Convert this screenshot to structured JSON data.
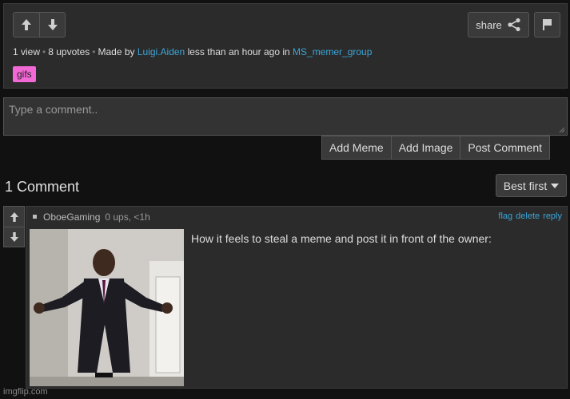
{
  "post": {
    "views": "1 view",
    "upvotes": "8 upvotes",
    "made_by_prefix": "Made by",
    "author": "Luigi.Aiden",
    "time_text": "less than an hour ago in",
    "group": "MS_memer_group",
    "share_label": "share",
    "tag": "gifs"
  },
  "comment_form": {
    "placeholder": "Type a comment..",
    "add_meme": "Add Meme",
    "add_image": "Add Image",
    "post_comment": "Post Comment"
  },
  "comments_header": {
    "count": "1 Comment",
    "sort_label": "Best first"
  },
  "comment": {
    "user": "OboeGaming",
    "stats": "0 ups, <1h",
    "actions": [
      "flag",
      "delete",
      "reply"
    ],
    "text": "How it feels to steal a meme and post it in front of the owner:"
  },
  "watermark": "imgflip.com",
  "colors": {
    "link": "#3ba6d8",
    "tag": "#f268d4",
    "panel": "#2b2b2b",
    "background": "#111111"
  }
}
